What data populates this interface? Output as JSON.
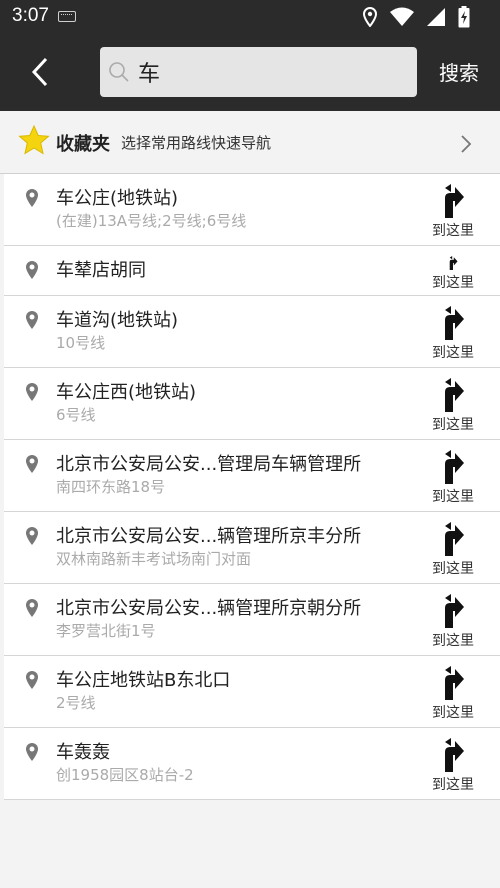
{
  "status": {
    "time": "3:07"
  },
  "toolbar": {
    "query": "车",
    "search_label": "搜索"
  },
  "favorites": {
    "title": "收藏夹",
    "subtitle": "选择常用路线快速导航"
  },
  "goto_label": "到这里",
  "results": [
    {
      "name": "车公庄(地铁站)",
      "sub": "(在建)13A号线;2号线;6号线"
    },
    {
      "name": "车辇店胡同",
      "sub": ""
    },
    {
      "name": "车道沟(地铁站)",
      "sub": "10号线"
    },
    {
      "name": "车公庄西(地铁站)",
      "sub": "6号线"
    },
    {
      "name": " 北京市公安局公安...管理局车辆管理所",
      "sub": "南四环东路18号"
    },
    {
      "name": " 北京市公安局公安...辆管理所京丰分所",
      "sub": "双林南路新丰考试场南门对面"
    },
    {
      "name": " 北京市公安局公安...辆管理所京朝分所",
      "sub": "李罗营北街1号"
    },
    {
      "name": "车公庄地铁站B东北口",
      "sub": "2号线"
    },
    {
      "name": "车轰轰",
      "sub": "创1958园区8站台-2"
    }
  ]
}
